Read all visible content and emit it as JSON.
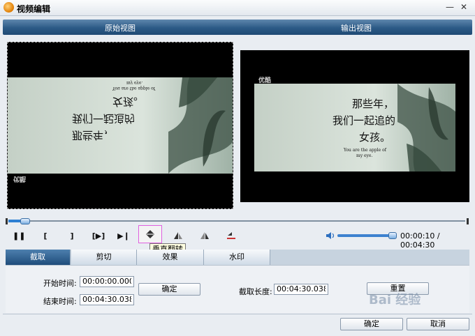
{
  "window": {
    "title": "视频编辑",
    "min_glyph": "—",
    "close_glyph": "✕"
  },
  "header": {
    "original_label": "原始视图",
    "output_label": "输出视图"
  },
  "frames": {
    "line1": "那些年，",
    "line2": "我们一起追的",
    "line3": "女孩。",
    "caption1": "You are the apple of",
    "caption2": "my eye.",
    "logo": "优酷"
  },
  "controls": {
    "pause_glyph": "❚❚",
    "mark_in_glyph": "[",
    "mark_out_glyph": "]",
    "clip_glyph": "[▶]",
    "next_glyph": "▶❙",
    "tooltip": "垂直翻转"
  },
  "playback": {
    "time": "00:00:10 / 00:04:30",
    "progress": 0.037,
    "volume": 1.0
  },
  "tabs": [
    {
      "label": "截取",
      "active": true
    },
    {
      "label": "剪切",
      "active": false
    },
    {
      "label": "效果",
      "active": false
    },
    {
      "label": "水印",
      "active": false
    }
  ],
  "trim": {
    "start_label": "开始时间:",
    "start_value": "00:00:00.000",
    "end_label": "结束时间:",
    "end_value": "00:04:30.038",
    "confirm_label": "确定",
    "length_label": "截取长度:",
    "length_value": "00:04:30.038",
    "reset_label": "重置"
  },
  "footer": {
    "ok_label": "确定",
    "cancel_label": "取消"
  },
  "watermark": "Bai 经验",
  "colors": {
    "accent": "#2c5a86",
    "highlight": "#e060e0"
  }
}
